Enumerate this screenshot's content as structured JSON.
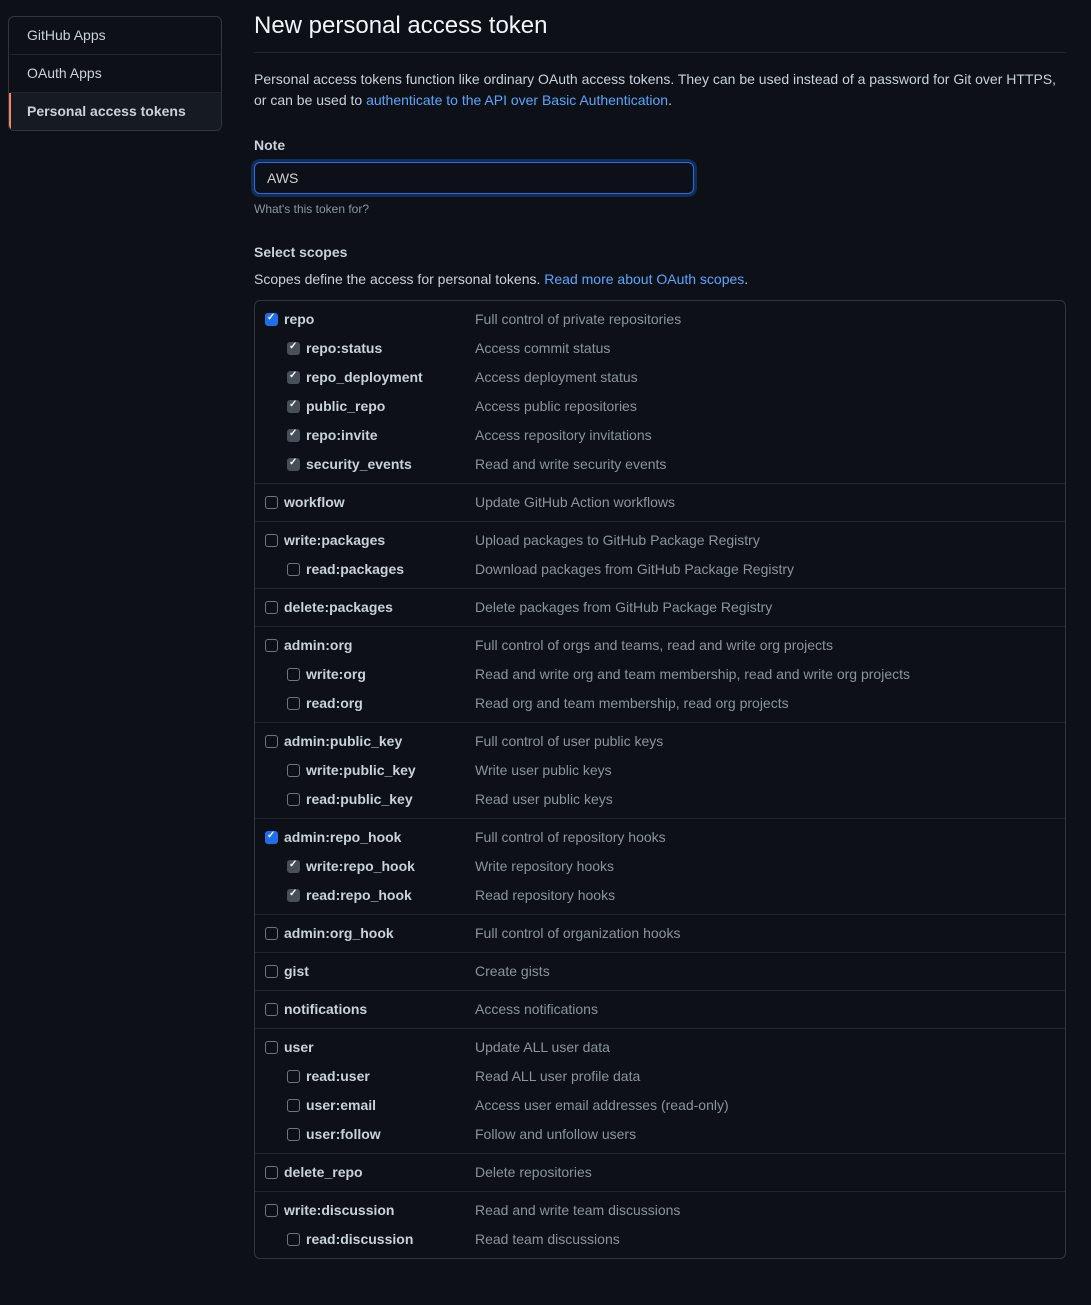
{
  "sidebar": {
    "items": [
      {
        "label": "GitHub Apps",
        "active": false
      },
      {
        "label": "OAuth Apps",
        "active": false
      },
      {
        "label": "Personal access tokens",
        "active": true
      }
    ]
  },
  "page": {
    "title": "New personal access token",
    "intro_pre": "Personal access tokens function like ordinary OAuth access tokens. They can be used instead of a password for Git over HTTPS, or can be used to ",
    "intro_link": "authenticate to the API over Basic Authentication",
    "intro_post": "."
  },
  "form": {
    "note_label": "Note",
    "note_value": "AWS",
    "note_hint": "What's this token for?",
    "scopes_label": "Select scopes",
    "scopes_intro_pre": "Scopes define the access for personal tokens. ",
    "scopes_intro_link": "Read more about OAuth scopes",
    "scopes_intro_post": "."
  },
  "scopes": [
    {
      "name": "repo",
      "desc": "Full control of private repositories",
      "checked": true,
      "children": [
        {
          "name": "repo:status",
          "desc": "Access commit status",
          "checked": true,
          "inherited": true
        },
        {
          "name": "repo_deployment",
          "desc": "Access deployment status",
          "checked": true,
          "inherited": true
        },
        {
          "name": "public_repo",
          "desc": "Access public repositories",
          "checked": true,
          "inherited": true
        },
        {
          "name": "repo:invite",
          "desc": "Access repository invitations",
          "checked": true,
          "inherited": true
        },
        {
          "name": "security_events",
          "desc": "Read and write security events",
          "checked": true,
          "inherited": true
        }
      ]
    },
    {
      "name": "workflow",
      "desc": "Update GitHub Action workflows",
      "checked": false,
      "children": []
    },
    {
      "name": "write:packages",
      "desc": "Upload packages to GitHub Package Registry",
      "checked": false,
      "children": [
        {
          "name": "read:packages",
          "desc": "Download packages from GitHub Package Registry",
          "checked": false
        }
      ]
    },
    {
      "name": "delete:packages",
      "desc": "Delete packages from GitHub Package Registry",
      "checked": false,
      "children": []
    },
    {
      "name": "admin:org",
      "desc": "Full control of orgs and teams, read and write org projects",
      "checked": false,
      "children": [
        {
          "name": "write:org",
          "desc": "Read and write org and team membership, read and write org projects",
          "checked": false
        },
        {
          "name": "read:org",
          "desc": "Read org and team membership, read org projects",
          "checked": false
        }
      ]
    },
    {
      "name": "admin:public_key",
      "desc": "Full control of user public keys",
      "checked": false,
      "children": [
        {
          "name": "write:public_key",
          "desc": "Write user public keys",
          "checked": false
        },
        {
          "name": "read:public_key",
          "desc": "Read user public keys",
          "checked": false
        }
      ]
    },
    {
      "name": "admin:repo_hook",
      "desc": "Full control of repository hooks",
      "checked": true,
      "children": [
        {
          "name": "write:repo_hook",
          "desc": "Write repository hooks",
          "checked": true,
          "inherited": true
        },
        {
          "name": "read:repo_hook",
          "desc": "Read repository hooks",
          "checked": true,
          "inherited": true
        }
      ]
    },
    {
      "name": "admin:org_hook",
      "desc": "Full control of organization hooks",
      "checked": false,
      "children": []
    },
    {
      "name": "gist",
      "desc": "Create gists",
      "checked": false,
      "children": []
    },
    {
      "name": "notifications",
      "desc": "Access notifications",
      "checked": false,
      "children": []
    },
    {
      "name": "user",
      "desc": "Update ALL user data",
      "checked": false,
      "children": [
        {
          "name": "read:user",
          "desc": "Read ALL user profile data",
          "checked": false
        },
        {
          "name": "user:email",
          "desc": "Access user email addresses (read-only)",
          "checked": false
        },
        {
          "name": "user:follow",
          "desc": "Follow and unfollow users",
          "checked": false
        }
      ]
    },
    {
      "name": "delete_repo",
      "desc": "Delete repositories",
      "checked": false,
      "children": []
    },
    {
      "name": "write:discussion",
      "desc": "Read and write team discussions",
      "checked": false,
      "children": [
        {
          "name": "read:discussion",
          "desc": "Read team discussions",
          "checked": false
        }
      ]
    }
  ]
}
